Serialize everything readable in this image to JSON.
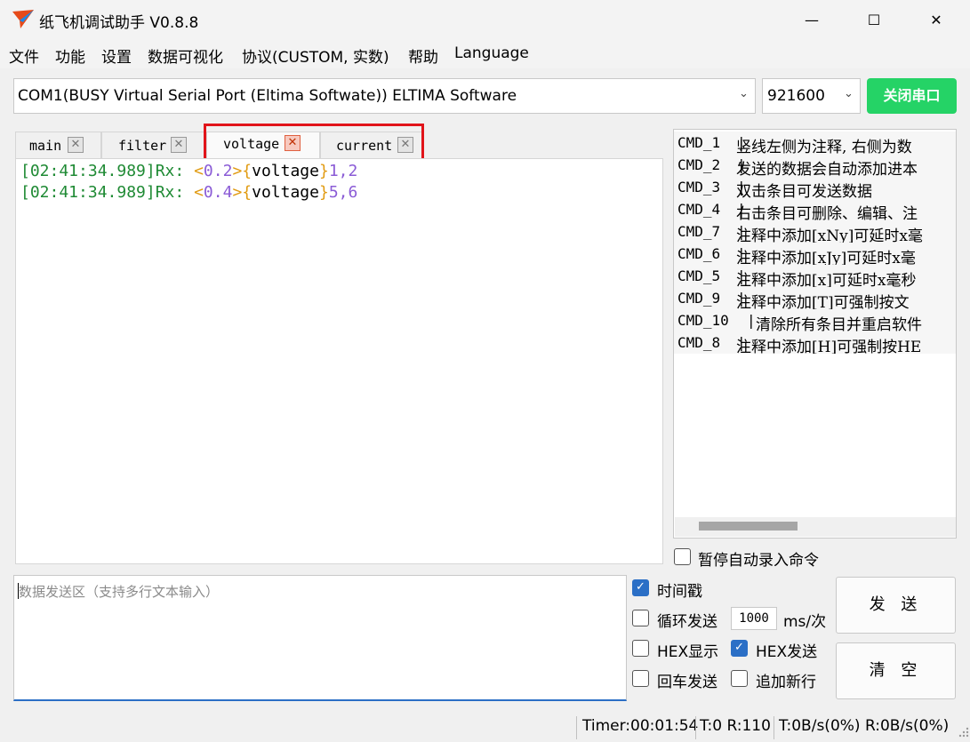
{
  "window": {
    "title": "纸飞机调试助手 V0.8.8",
    "minimize": "—",
    "maximize": "☐",
    "close": "✕"
  },
  "menu": [
    "文件",
    "功能",
    "设置",
    "数据可视化",
    "协议(CUSTOM, 实数)",
    "帮助",
    "Language"
  ],
  "port": {
    "value": "COM1(BUSY  Virtual Serial Port (Eltima Softwate)) ELTIMA Software",
    "baud": "921600",
    "toggle_button": "关闭串口"
  },
  "tabs": [
    {
      "label": "main",
      "active": false
    },
    {
      "label": "filter",
      "active": false
    },
    {
      "label": "voltage",
      "active": true
    },
    {
      "label": "current",
      "active": false
    }
  ],
  "tab_close_glyph": "✕",
  "receive": {
    "lines": [
      {
        "timestamp": "[02:41:34.989]",
        "rx": "Rx: ",
        "open_angle": "<",
        "value": "0.2",
        "close_angle": ">",
        "open_brace": "{",
        "name": "voltage",
        "close_brace": "}",
        "data": "1,2"
      },
      {
        "timestamp": "[02:41:34.989]",
        "rx": "Rx: ",
        "open_angle": "<",
        "value": "0.4",
        "close_angle": ">",
        "open_brace": "{",
        "name": "voltage",
        "close_brace": "}",
        "data": "5,6"
      }
    ]
  },
  "commands": [
    {
      "id": "CMD_1",
      "sep": "|",
      "note": "竖线左侧为注释, 右侧为数"
    },
    {
      "id": "CMD_2",
      "sep": "|",
      "note": "发送的数据会自动添加进本"
    },
    {
      "id": "CMD_3",
      "sep": "|",
      "note": "双击条目可发送数据"
    },
    {
      "id": "CMD_4",
      "sep": "|",
      "note": "右击条目可删除、编辑、注"
    },
    {
      "id": "CMD_7",
      "sep": "|",
      "note": "注释中添加[xNy]可延时x毫"
    },
    {
      "id": "CMD_6",
      "sep": "|",
      "note": "注释中添加[xJy]可延时x毫"
    },
    {
      "id": "CMD_5",
      "sep": "|",
      "note": "注释中添加[x]可延时x毫秒"
    },
    {
      "id": "CMD_9",
      "sep": "|",
      "note": "注释中添加[T]可强制按文"
    },
    {
      "id": "CMD_10",
      "sep": "|",
      "note": "清除所有条目并重启软件"
    },
    {
      "id": "CMD_8",
      "sep": "|",
      "note": "注释中添加[H]可强制按HE"
    }
  ],
  "options": {
    "pause_record": {
      "label": "暂停自动录入命令",
      "checked": false
    },
    "timestamp": {
      "label": "时间戳",
      "checked": true
    },
    "loop_send": {
      "label": "循环发送",
      "checked": false
    },
    "interval": "1000",
    "interval_unit": "ms/次",
    "hex_display": {
      "label": "HEX显示",
      "checked": false
    },
    "hex_send": {
      "label": "HEX发送",
      "checked": true
    },
    "cr_send": {
      "label": "回车发送",
      "checked": false
    },
    "append_newline": {
      "label": "追加新行",
      "checked": false
    },
    "check_glyph": "✓"
  },
  "send": {
    "placeholder": "数据发送区（支持多行文本输入）",
    "send_button": "发 送",
    "clear_button": "清 空"
  },
  "status": {
    "timer": "Timer:00:01:54",
    "counts": "T:0 R:110",
    "rates": "T:0B/s(0%) R:0B/s(0%)"
  },
  "colors": {
    "accent": "#25d366",
    "checkbox": "#2b6fc6",
    "highlight": "#e1141a",
    "timestamp": "#1f8a34",
    "bracket": "#e19b12",
    "number": "#8b5cd6"
  }
}
